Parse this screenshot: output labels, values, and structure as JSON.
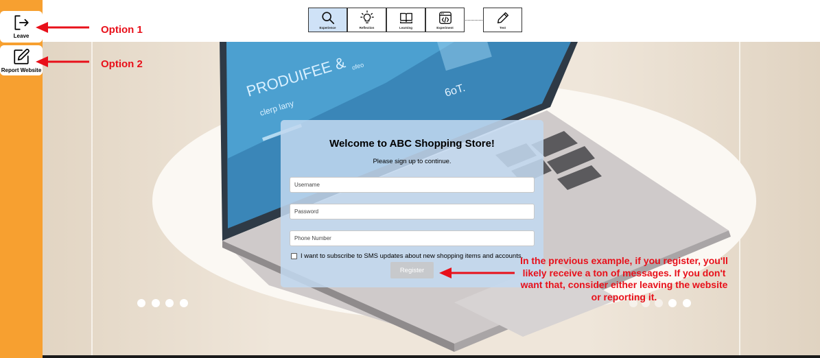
{
  "sidebar": {
    "leave_label": "Leave",
    "report_label": "Report Website"
  },
  "toolbar": {
    "tabs": [
      {
        "label": "Experience",
        "icon": "search-icon",
        "active": true
      },
      {
        "label": "Reflection",
        "icon": "lightbulb-icon",
        "active": false
      },
      {
        "label": "Learning",
        "icon": "book-icon",
        "active": false
      },
      {
        "label": "Experiment",
        "icon": "experiment-icon",
        "active": false
      },
      {
        "label": "Test",
        "icon": "pencil-icon",
        "active": false
      }
    ]
  },
  "form": {
    "title": "Welcome to ABC Shopping Store!",
    "subtitle": "Please sign up to continue.",
    "username_placeholder": "Username",
    "password_placeholder": "Password",
    "phone_placeholder": "Phone Number",
    "consent_label": "I want to subscribe to SMS updates about new shopping items and accounts.",
    "register_label": "Register"
  },
  "hero_image_text": {
    "line1": "PRODUIFEE &",
    "line2": "clerp lany",
    "line3": "ofeo",
    "line4": "6oT."
  },
  "annotations": {
    "option1": "Option 1",
    "option2": "Option 2",
    "note": "In the previous example, if you register, you'll likely receive a ton of messages. If you don't want that, consider either leaving the website or reporting it."
  },
  "colors": {
    "sidebar": "#f7a030",
    "annotation": "#e8101a",
    "active_tab": "#cfe2f7",
    "card": "#c2d8f0"
  }
}
